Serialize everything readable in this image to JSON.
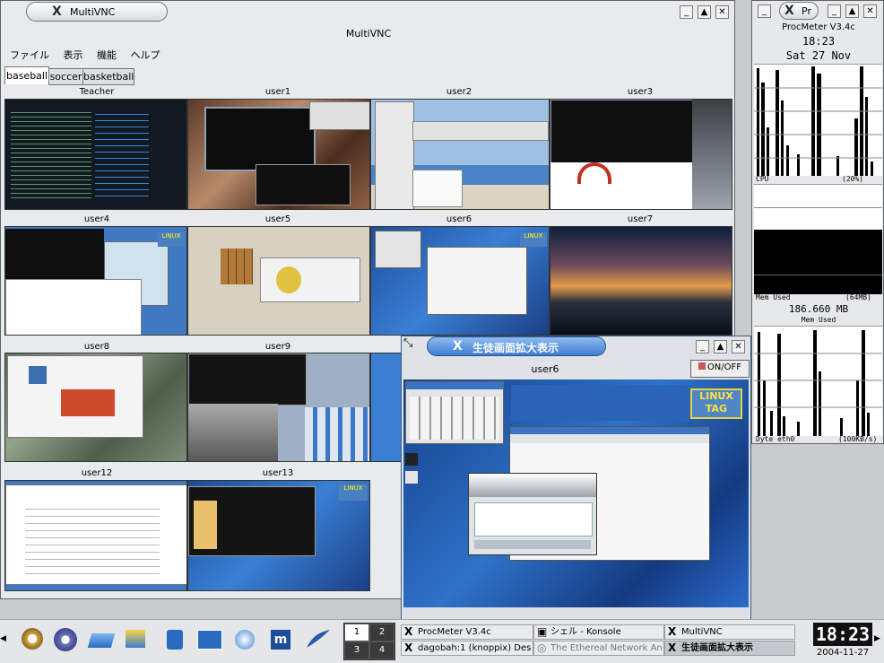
{
  "main_window": {
    "title": "MultiVNC",
    "inner_title": "MultiVNC",
    "menu": [
      "ファイル",
      "表示",
      "機能",
      "ヘルプ"
    ],
    "tabs": [
      "baseball",
      "soccer",
      "basketball"
    ],
    "grid_labels": [
      "Teacher",
      "user1",
      "user2",
      "user3",
      "user4",
      "user5",
      "user6",
      "user7",
      "user8",
      "user9",
      "user12",
      "user13"
    ]
  },
  "zoom_window": {
    "title": "生徒画面拡大表示",
    "label": "user6",
    "toggle": "ON/OFF",
    "banner": [
      "LINUX",
      "TAG"
    ]
  },
  "procmeter": {
    "title": "Pr",
    "app_name": "ProcMeter V3.4c",
    "time": "18:23",
    "date": "Sat 27 Nov",
    "cpu_label": "CPU",
    "cpu_value": "(20%)",
    "mem_label": "Mem Used",
    "mem_value": "(64MB)",
    "mem_total": "186.660 MB",
    "mem_total_label": "Mem Used",
    "disk_label": "Dyte eth0",
    "disk_value": "(100KB/s)"
  },
  "taskbar": {
    "desktops": [
      "1",
      "2",
      "3",
      "4"
    ],
    "tasks": [
      "ProcMeter V3.4c",
      "シェル - Konsole",
      "MultiVNC",
      "dagobah:1 (knoppix) Des",
      "The Ethereal Network An",
      "生徒画面拡大表示"
    ],
    "clock": "18:23",
    "date": "2004-11-27"
  },
  "colors": {
    "accent": "#2d6fd1",
    "title_bg": "#e6e8ea"
  }
}
